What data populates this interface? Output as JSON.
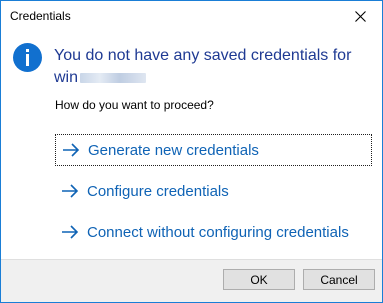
{
  "window": {
    "title": "Credentials"
  },
  "message": {
    "line1": "You do not have any saved credentials for",
    "line2_prefix": "win"
  },
  "question": "How do you want to proceed?",
  "options": [
    {
      "label": "Generate new credentials"
    },
    {
      "label": "Configure credentials"
    },
    {
      "label": "Connect without configuring credentials"
    }
  ],
  "buttons": {
    "ok": "OK",
    "cancel": "Cancel"
  },
  "colors": {
    "accent": "#1a7ed6",
    "link": "#0f63b5",
    "heading": "#1f3a93",
    "info_icon": "#1170cf"
  },
  "icons": {
    "info": "info-icon",
    "close": "close-icon",
    "arrow": "arrow-right-icon"
  }
}
